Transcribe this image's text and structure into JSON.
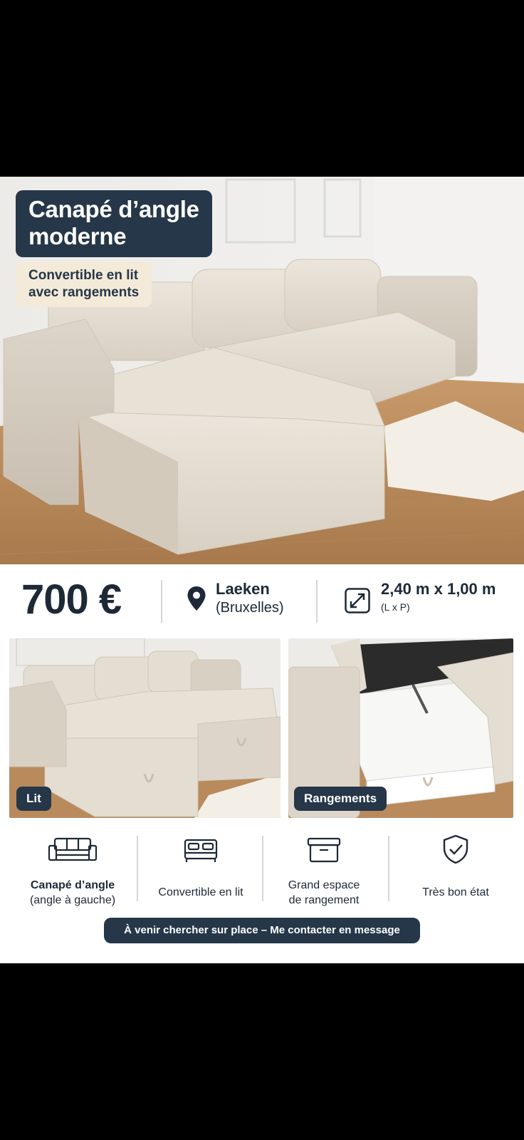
{
  "listing": {
    "title_line1": "Canapé d’angle",
    "title_line2": "moderne",
    "subtitle_line1": "Convertible en lit",
    "subtitle_line2": "avec rangements"
  },
  "info": {
    "price": "700 €",
    "location_city": "Laeken",
    "location_region": "(Bruxelles)",
    "dimensions": "2,40 m x 1,00 m",
    "dimensions_note": "(L x P)"
  },
  "photos": [
    {
      "label": "Lit"
    },
    {
      "label": "Rangements"
    }
  ],
  "features": [
    {
      "icon": "sofa-icon",
      "line1": "Canapé d’angle",
      "line2": "(angle à gauche)"
    },
    {
      "icon": "bed-icon",
      "line1": "Convertible en lit",
      "line2": ""
    },
    {
      "icon": "storage-box-icon",
      "line1": "Grand espace",
      "line2": "de rangement"
    },
    {
      "icon": "shield-check-icon",
      "line1": "Très bon état",
      "line2": ""
    }
  ],
  "cta": {
    "label": "À venir chercher sur place – Me contacter en message"
  },
  "colors": {
    "navy": "#253748",
    "beige_badge": "#f4ead9",
    "sofa": "#e4ddd2",
    "floor": "#b98a5c"
  }
}
